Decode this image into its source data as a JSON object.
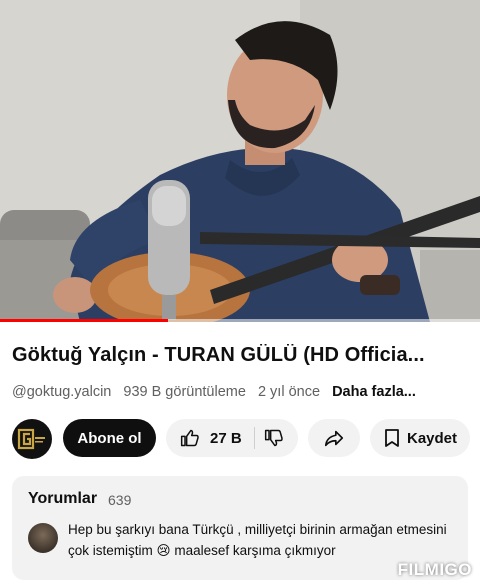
{
  "video": {
    "thumbnail": "man-playing-baglama-with-microphone",
    "progress_fraction": 0.35
  },
  "title": "Göktuğ Yalçın - TURAN GÜLÜ (HD Officia...",
  "meta": {
    "channel_handle": "@goktug.yalcin",
    "views": "939 B görüntüleme",
    "age": "2 yıl önce",
    "more": "Daha fazla..."
  },
  "actions": {
    "channel_logo_icon": "channel-logo-icon",
    "subscribe_label": "Abone ol",
    "like_count": "27 B",
    "like_icon": "thumbs-up-icon",
    "dislike_icon": "thumbs-down-icon",
    "share_icon": "share-icon",
    "save_label": "Kaydet",
    "save_icon": "bookmark-icon"
  },
  "comments": {
    "heading": "Yorumlar",
    "count": "639",
    "top_comment": "Hep bu şarkıyı bana Türkçü , milliyetçi birinin  armağan etmesini çok istemiştim 😢 maalesef karşıma çıkmıyor"
  },
  "watermark": "FILMIGO",
  "colors": {
    "progress": "#ff0000",
    "subscribe_bg": "#0f0f0f",
    "pill_bg": "#f2f2f2",
    "secondary_text": "#606060"
  }
}
